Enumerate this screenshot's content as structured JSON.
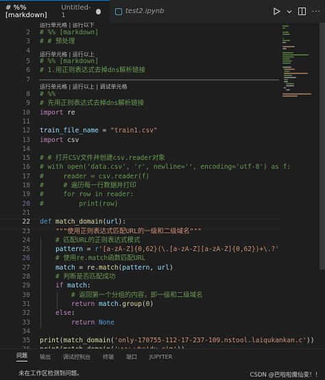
{
  "tabs": [
    {
      "label": "# %% [markdown]",
      "suffix": "Untitled-1",
      "state": "active"
    },
    {
      "label": "test2.ipynb",
      "state": "inactive"
    }
  ],
  "toolbar_icons": [
    "run-icon",
    "chevron-down-icon",
    "split-editor-icon",
    "more-icon"
  ],
  "editor": {
    "current_line": "22",
    "cells": [
      {
        "codelens": "运行单元格 | 运行以下",
        "lines": [
          {
            "n": "",
            "tokens": [
              {
                "t": "# %% [markdown]",
                "c": "com"
              }
            ]
          },
          {
            "n": "",
            "tokens": [
              {
                "t": "# # 预处理",
                "c": "com"
              }
            ]
          }
        ]
      }
    ],
    "codelens": {
      "c1": "运行单元格 | 运行以下",
      "c2": "运行单元格 | 运行以上",
      "c3": "运行单元格 | 运行以上 | 调试单元格"
    },
    "lines": [
      {
        "n": "2",
        "code": "# %% [markdown]"
      },
      {
        "n": "3",
        "code": "# # 预处理"
      },
      {
        "n": "4",
        "code": ""
      },
      {
        "n": "5",
        "code": "# %% [markdown]"
      },
      {
        "n": "6",
        "code": "# 1.用正则表达式去掉dns解析链接"
      },
      {
        "n": "7",
        "code": ""
      },
      {
        "n": "8",
        "code": "# %%"
      },
      {
        "n": "9",
        "code": "# 先用正则表达式去掉dns解析链接"
      },
      {
        "n": "10",
        "code": "import re"
      },
      {
        "n": "11",
        "code": ""
      },
      {
        "n": "12",
        "code": "train_file_name = \"train1.csv\""
      },
      {
        "n": "13",
        "code": "import csv"
      },
      {
        "n": "14",
        "code": ""
      },
      {
        "n": "15",
        "code": "# # 打开CSV文件并创建csv.reader对象"
      },
      {
        "n": "16",
        "code": "# with open('data.csv', 'r', newline='', encoding='utf-8') as f:"
      },
      {
        "n": "17",
        "code": "#     reader = csv.reader(f)"
      },
      {
        "n": "18",
        "code": "#     # 遍历每一行数据并打印"
      },
      {
        "n": "19",
        "code": "#     for row in reader:"
      },
      {
        "n": "20",
        "code": "#         print(row)"
      },
      {
        "n": "21",
        "code": ""
      },
      {
        "n": "22",
        "code": "def match_domain(url):"
      },
      {
        "n": "23",
        "code": "    \"\"\"使用正则表达式匹配URL的一级和二级域名\"\"\""
      },
      {
        "n": "24",
        "code": "    # 匹配URL的正则表达式模式"
      },
      {
        "n": "25",
        "code": "    pattern = r'[a-zA-Z]{0,62}(\\.[a-zA-Z][a-zA-Z]{0,62})+\\.?'"
      },
      {
        "n": "26",
        "code": "    # 使用re.match函数匹配URL"
      },
      {
        "n": "27",
        "code": "    match = re.match(pattern, url)"
      },
      {
        "n": "28",
        "code": "    # 判断是否匹配成功"
      },
      {
        "n": "29",
        "code": "    if match:"
      },
      {
        "n": "30",
        "code": "        # 返回第一个分组的内容，即一级和二级域名"
      },
      {
        "n": "31",
        "code": "        return match.group(0)"
      },
      {
        "n": "32",
        "code": "    else:"
      },
      {
        "n": "33",
        "code": "        return None"
      },
      {
        "n": "34",
        "code": ""
      },
      {
        "n": "35",
        "code": "print(match_domain('only-170755-112-17-237-109.nstool.laiqukankan.c'))"
      },
      {
        "n": "36",
        "code": "print(match_domain('www.wbaidu.cim'))"
      },
      {
        "n": "37",
        "code": ""
      }
    ]
  },
  "panel": {
    "tabs": [
      "问题",
      "输出",
      "调试控制台",
      "终端",
      "端口",
      "JUPYTER"
    ],
    "active_tab": "问题",
    "message": "未在工作区检测到问题。",
    "watermark": "CSDN @巴啦啦魔仙变！！"
  }
}
